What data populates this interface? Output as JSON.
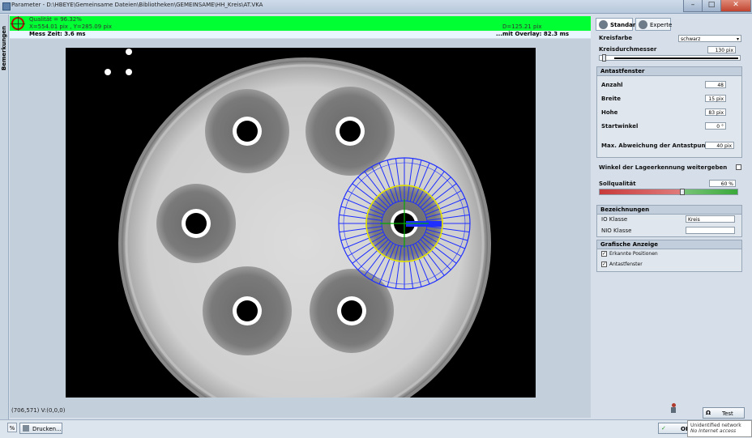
{
  "window": {
    "title": "Parameter - D:\\HBEYE\\Gemeinsame Dateien\\Bibliotheken\\GEMEINSAME\\HH_Kreis\\AT.VKA",
    "min_label": "–",
    "max_label": "□",
    "close_label": "✕"
  },
  "side_tab": {
    "label": "Bemerkungen"
  },
  "status": {
    "quality": "Qualität = 96.32%",
    "coords": "X=554.01 pix , Y=285.09 pix",
    "diameter": "D=125.21 pix",
    "mess_zeit": "Mess Zeit: 3.6 ms",
    "overlay_zeit": "...mit Overlay: 82.3 ms",
    "ok_color": "#00ff33"
  },
  "image": {
    "cursor_info": "(706,571) V:(0,0,0)",
    "overlay_color": "#1f2fff",
    "circle_color": "#e8e800",
    "rays": 48
  },
  "tabs": [
    {
      "label": "Standard",
      "icon": "standard-icon"
    },
    {
      "label": "Experte",
      "icon": "experte-icon"
    }
  ],
  "settings": {
    "kreisfarbe_label": "Kreisfarbe",
    "kreisfarbe_value": "schwarz",
    "kreisdurchmesser_label": "Kreisdurchmesser",
    "kreisdurchmesser_value": "130 pix",
    "antast": {
      "title": "Antastfenster",
      "anzahl_label": "Anzahl",
      "anzahl_value": "48",
      "breite_label": "Breite",
      "breite_value": "15 pix",
      "hoehe_label": "Hohe",
      "hoehe_value": "83 pix",
      "startwinkel_label": "Startwinkel",
      "startwinkel_value": "0 °",
      "max_abw_label": "Max. Abweichung der Antastpunkte",
      "max_abw_value": "40 pix"
    },
    "winkel_label": "Winkel der Lageerkennung weitergeben",
    "sollqualitaet_label": "Sollqualität",
    "sollqualitaet_value": "60 %",
    "bezeichnungen": {
      "title": "Bezeichnungen",
      "io_label": "IO Klasse",
      "io_value": "Kreis",
      "nio_label": "NIO Klasse",
      "nio_value": ""
    },
    "grafik": {
      "title": "Grafische Anzeige",
      "erkannte_label": "Erkannte Positionen",
      "antast_label": "Antastfenster"
    }
  },
  "buttons": {
    "drucken": "Drucken...",
    "test": "Test",
    "ok": "OK"
  },
  "notification": {
    "line1": "Unidentified network",
    "line2": "No Internet access"
  }
}
